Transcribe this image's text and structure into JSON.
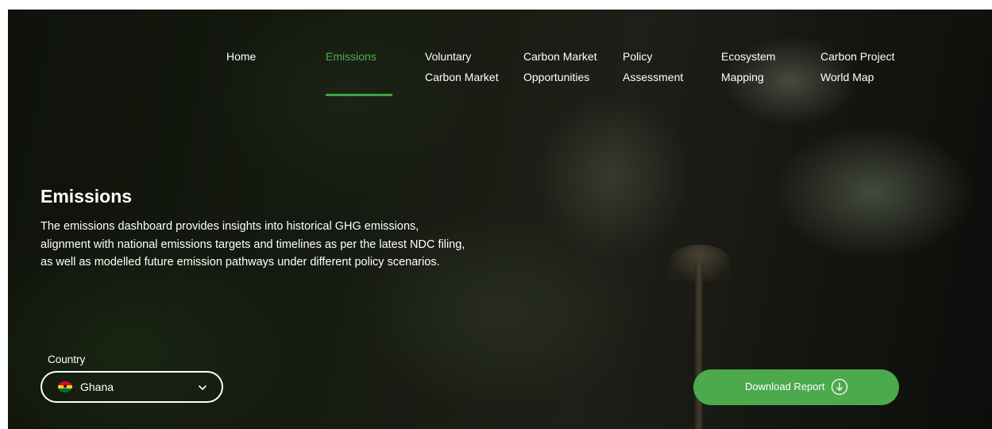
{
  "nav": {
    "items": [
      {
        "line1": "Home",
        "line2": ""
      },
      {
        "line1": "Emissions",
        "line2": ""
      },
      {
        "line1": "Voluntary",
        "line2": "Carbon Market"
      },
      {
        "line1": "Carbon Market",
        "line2": "Opportunities"
      },
      {
        "line1": "Policy",
        "line2": "Assessment"
      },
      {
        "line1": "Ecosystem",
        "line2": "Mapping"
      },
      {
        "line1": "Carbon Project",
        "line2": "World Map"
      }
    ],
    "active_item": "Emissions"
  },
  "hero": {
    "title": "Emissions",
    "description": "The emissions dashboard provides insights into historical GHG emissions, alignment with national emissions targets and timelines as per the latest NDC filing, as well as modelled future emission pathways under different policy scenarios."
  },
  "country": {
    "label": "Country",
    "selected": "Ghana",
    "flag_colors": [
      "#ce1126",
      "#fcd116",
      "#006b3f"
    ],
    "icon": "chevron-down-icon"
  },
  "download": {
    "label": "Download Report",
    "icon": "download-arrow-icon"
  },
  "colors": {
    "accent": "#4ca94c",
    "active_nav": "#4fae4f"
  }
}
